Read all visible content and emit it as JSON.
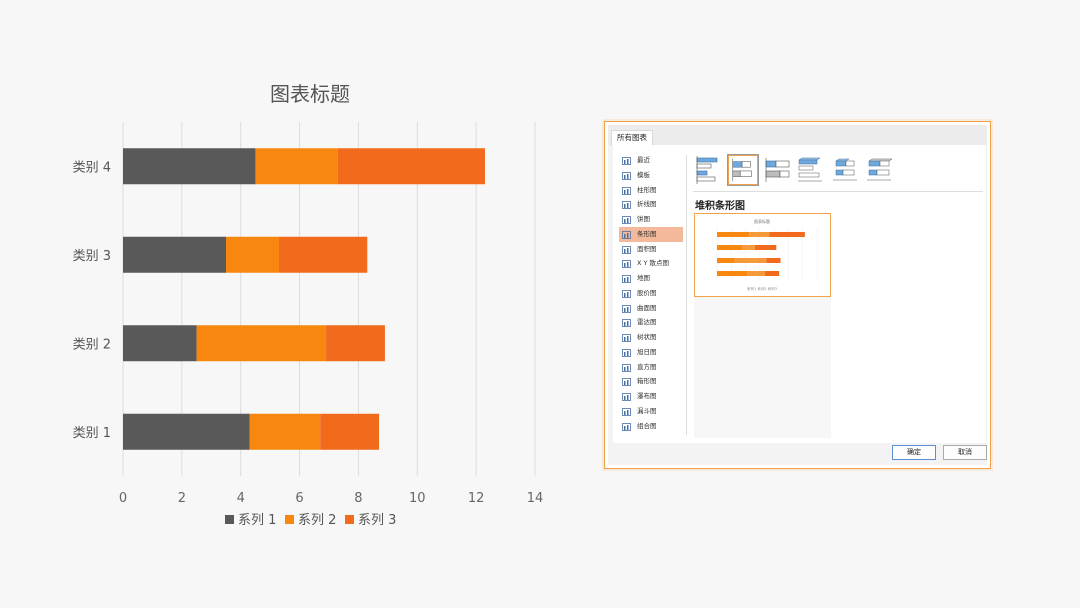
{
  "chart_data": {
    "type": "bar",
    "orientation": "horizontal",
    "stacked": true,
    "title": "图表标题",
    "categories": [
      "类别 1",
      "类别 2",
      "类别 3",
      "类别 4"
    ],
    "series": [
      {
        "name": "系列 1",
        "values": [
          4.3,
          2.5,
          3.5,
          4.5
        ],
        "color": "#595959"
      },
      {
        "name": "系列 2",
        "values": [
          2.4,
          4.4,
          1.8,
          2.8
        ],
        "color": "#f7870f"
      },
      {
        "name": "系列 3",
        "values": [
          2.0,
          2.0,
          3.0,
          5.0
        ],
        "color": "#f26b1d"
      }
    ],
    "xlim": [
      0,
      14
    ],
    "xticks": [
      "0",
      "2",
      "4",
      "6",
      "8",
      "10",
      "12",
      "14"
    ],
    "grid": true,
    "legend": "bottom"
  },
  "dialog": {
    "tab_label": "所有图表",
    "categories": [
      "最近",
      "模板",
      "柱形图",
      "折线图",
      "饼图",
      "条形图",
      "面积图",
      "X Y 散点图",
      "地图",
      "股价图",
      "曲面图",
      "雷达图",
      "树状图",
      "旭日图",
      "直方图",
      "箱形图",
      "瀑布图",
      "漏斗图",
      "组合图"
    ],
    "selected_category": "条形图",
    "subtype_title": "堆积条形图",
    "preview_title": "图表标题",
    "preview_legend": "系列1  系列2  系列3",
    "ok_label": "确定",
    "cancel_label": "取消",
    "accent_color": "#f2a24a"
  }
}
